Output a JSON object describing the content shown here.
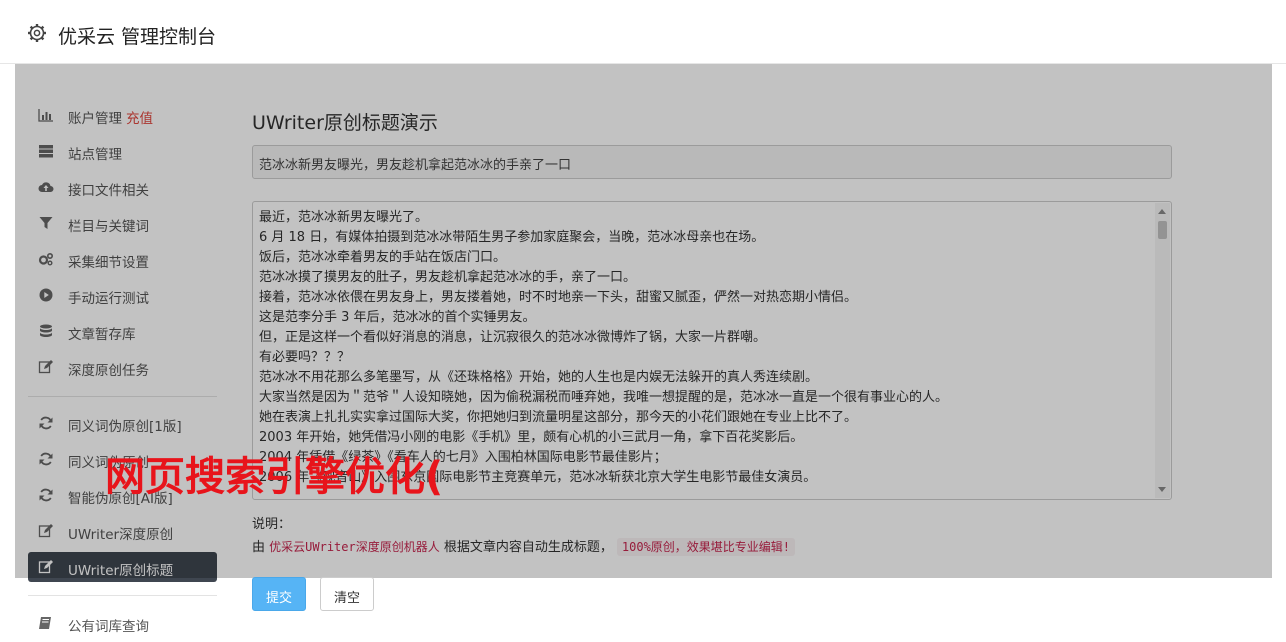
{
  "header": {
    "title": "优采云 管理控制台",
    "icon": "gear-icon"
  },
  "sidebar": {
    "items": [
      {
        "label": "账户管理",
        "extra": "充值",
        "icon": "bar-chart-icon"
      },
      {
        "label": "站点管理",
        "icon": "server-icon"
      },
      {
        "label": "接口文件相关",
        "icon": "cloud-upload-icon"
      },
      {
        "label": "栏目与关键词",
        "icon": "filter-icon"
      },
      {
        "label": "采集细节设置",
        "icon": "cogs-icon"
      },
      {
        "label": "手动运行测试",
        "icon": "play-circle-icon"
      },
      {
        "label": "文章暂存库",
        "icon": "database-icon"
      },
      {
        "label": "深度原创任务",
        "icon": "edit-icon"
      },
      {
        "label": "同义词伪原创[1版]",
        "icon": "refresh-icon"
      },
      {
        "label": "同义词伪原创",
        "icon": "refresh-icon"
      },
      {
        "label": "智能伪原创[AI版]",
        "icon": "refresh-icon"
      },
      {
        "label": "UWriter深度原创",
        "icon": "edit-icon"
      },
      {
        "label": "UWriter原创标题",
        "icon": "edit-icon",
        "active": true
      },
      {
        "label": "公有词库查询",
        "icon": "book-icon"
      }
    ]
  },
  "main": {
    "title": "UWriter原创标题演示",
    "title_value": "范冰冰新男友曝光，男友趁机拿起范冰冰的手亲了一口",
    "article_lines": [
      "最近，范冰冰新男友曝光了。",
      "6 月 18 日，有媒体拍摄到范冰冰带陌生男子参加家庭聚会，当晚，范冰冰母亲也在场。",
      "饭后，范冰冰牵着男友的手站在饭店门口。",
      "范冰冰摸了摸男友的肚子，男友趁机拿起范冰冰的手，亲了一口。",
      "接着，范冰冰依偎在男友身上，男友搂着她，时不时地亲一下头，甜蜜又腻歪，俨然一对热恋期小情侣。",
      "这是范李分手 3 年后，范冰冰的首个实锤男友。",
      "但，正是这样一个看似好消息的消息，让沉寂很久的范冰冰微博炸了锅，大家一片群嘲。",
      "有必要吗？？？",
      "范冰冰不用花那么多笔墨写，从《还珠格格》开始，她的人生也是内娱无法躲开的真人秀连续剧。",
      "大家当然是因为＂范爷＂人设知晓她，因为偷税漏税而唾弃她，我唯一想提醒的是，范冰冰一直是一个很有事业心的人。",
      "她在表演上扎扎实实拿过国际大奖，你把她归到流量明星这部分，那今天的小花们跟她在专业上比不了。",
      "2003 年开始，她凭借冯小刚的电影《手机》里，颇有心机的小三武月一角，拿下百花奖影后。",
      "2004 年凭借《绿茶》《看车人的七月》入围柏林国际电影节最佳影片；",
      "2006 年《观音山》入围东京国际电影节主竞赛单元，范冰冰斩获北京大学生电影节最佳女演员。"
    ],
    "desc_label": "说明：",
    "desc_prefix": "由",
    "desc_link": "优采云UWriter深度原创机器人",
    "desc_middle": "根据文章内容自动生成标题，",
    "desc_code": "100%原创，效果堪比专业编辑!"
  },
  "buttons": {
    "submit": "提交",
    "clear": "清空"
  },
  "watermark": "网页搜索引擎优化(",
  "colors": {
    "active_bg": "#3f4650",
    "submit_bg": "#56b4f5",
    "accent_red": "#e0463e",
    "code_pink": "#c7254e"
  }
}
